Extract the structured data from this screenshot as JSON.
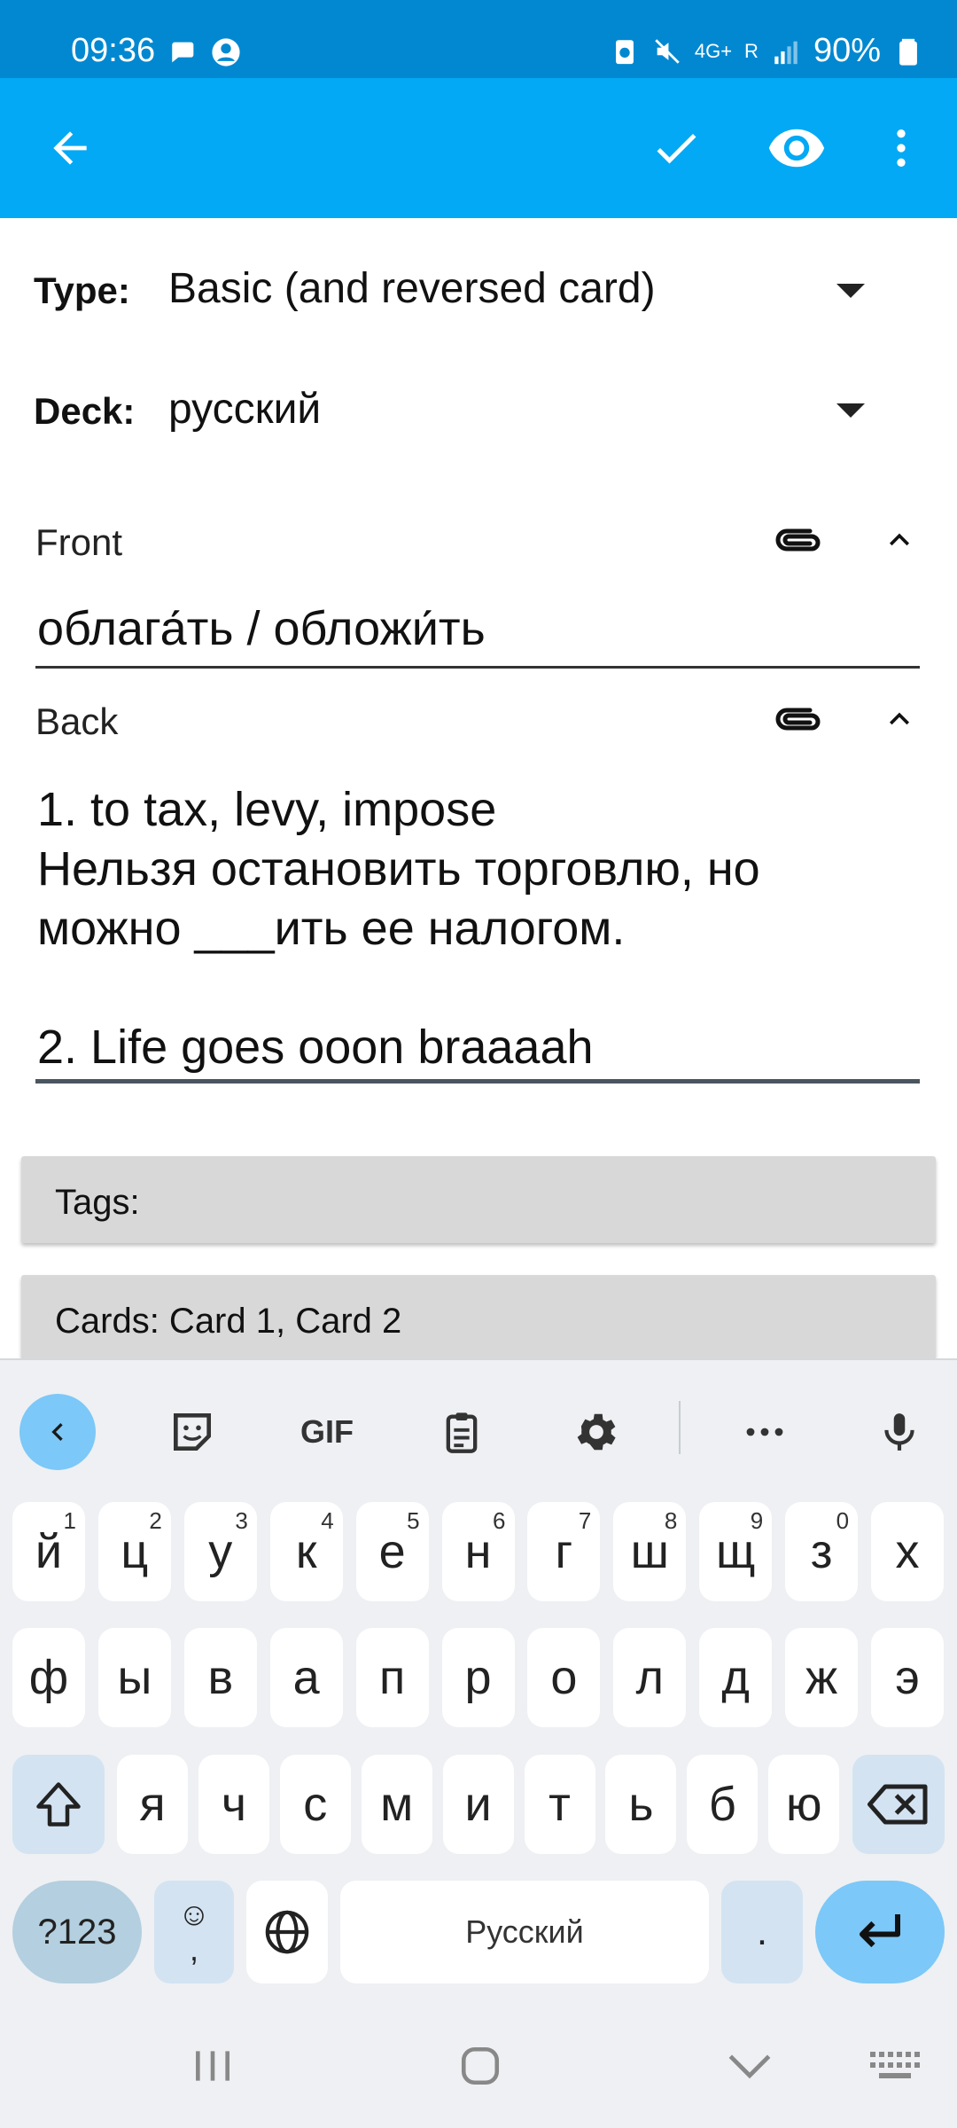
{
  "status_bar": {
    "time": "09:36",
    "battery_percent": "90%",
    "network": "4G+",
    "roaming": "R"
  },
  "app_bar": {
    "icons": [
      "back-arrow-icon",
      "checkmark-icon",
      "eye-icon",
      "more-vert-icon"
    ]
  },
  "note_type": {
    "label": "Type:",
    "value": "Basic (and reversed card)"
  },
  "deck": {
    "label": "Deck:",
    "value": "русский"
  },
  "fields": [
    {
      "label": "Front",
      "value": "облага́ть / обложи́ть"
    },
    {
      "label": "Back",
      "value": "1. to tax, levy, impose\nНельзя остановить торговлю, но\nможно ___ить ее налогом.\n\n2. Life goes ooon braaaah"
    }
  ],
  "tags": {
    "label": "Tags:"
  },
  "cards": {
    "label": "Cards: Card 1, Card 2"
  },
  "keyboard": {
    "toolbar": [
      "back-chevron-icon",
      "sticker-icon",
      "GIF",
      "clipboard-icon",
      "gear-icon",
      "more-horiz-icon",
      "mic-icon"
    ],
    "row1": [
      {
        "k": "й",
        "h": "1"
      },
      {
        "k": "ц",
        "h": "2"
      },
      {
        "k": "у",
        "h": "3"
      },
      {
        "k": "к",
        "h": "4"
      },
      {
        "k": "е",
        "h": "5"
      },
      {
        "k": "н",
        "h": "6"
      },
      {
        "k": "г",
        "h": "7"
      },
      {
        "k": "ш",
        "h": "8"
      },
      {
        "k": "щ",
        "h": "9"
      },
      {
        "k": "з",
        "h": "0"
      },
      {
        "k": "х",
        "h": ""
      }
    ],
    "row2": [
      "ф",
      "ы",
      "в",
      "а",
      "п",
      "р",
      "о",
      "л",
      "д",
      "ж",
      "э"
    ],
    "row3": [
      "я",
      "ч",
      "с",
      "м",
      "и",
      "т",
      "ь",
      "б",
      "ю"
    ],
    "symbols_label": "?123",
    "emoji_label": "☺",
    "comma_label": ",",
    "space_label": "Русский",
    "period_label": "."
  },
  "colors": {
    "status_bar": "#0288d1",
    "app_bar": "#03a9f4",
    "keyboard_accent": "#7cc8f8"
  }
}
